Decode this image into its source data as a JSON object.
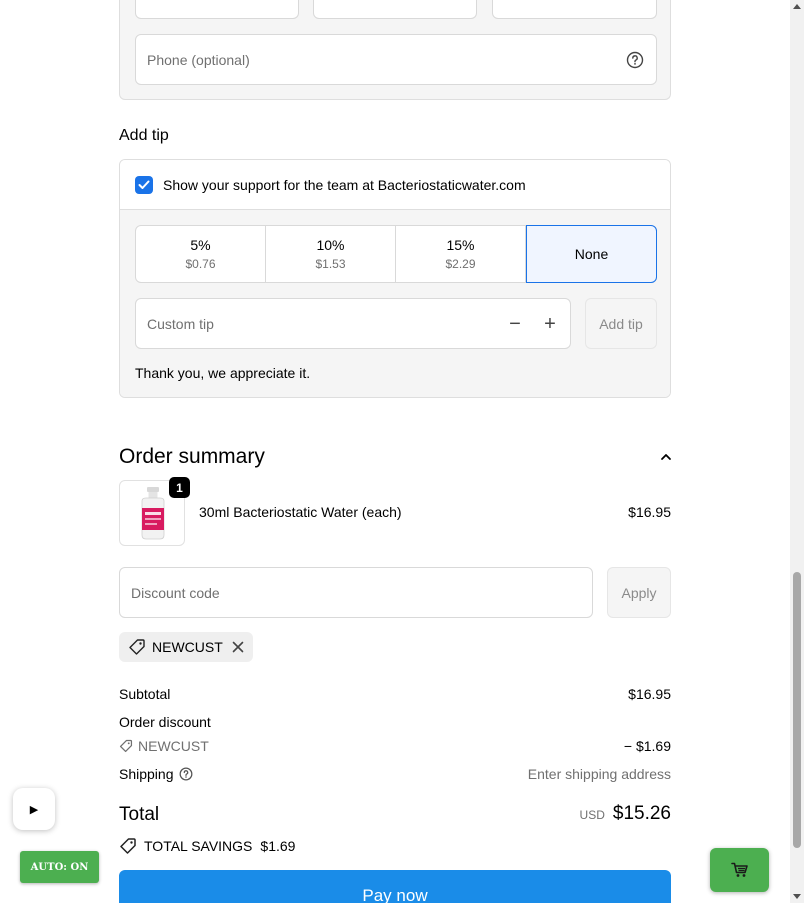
{
  "contact": {
    "phone_placeholder": "Phone (optional)"
  },
  "tip": {
    "title": "Add tip",
    "checkbox_label": "Show your support for the team at Bacteriostaticwater.com",
    "options": [
      {
        "percent": "5%",
        "amount": "$0.76"
      },
      {
        "percent": "10%",
        "amount": "$1.53"
      },
      {
        "percent": "15%",
        "amount": "$2.29"
      },
      {
        "label": "None",
        "selected": true
      }
    ],
    "custom_placeholder": "Custom tip",
    "decrement": "−",
    "increment": "+",
    "add_button": "Add tip",
    "thanks": "Thank you, we appreciate it."
  },
  "summary": {
    "title": "Order summary",
    "item": {
      "name": "30ml Bacteriostatic Water (each)",
      "price": "$16.95",
      "quantity": "1"
    },
    "discount_placeholder": "Discount code",
    "apply_button": "Apply",
    "applied_code": "NEWCUST",
    "subtotal_label": "Subtotal",
    "subtotal_value": "$16.95",
    "order_discount_label": "Order discount",
    "order_discount_code": "NEWCUST",
    "order_discount_value": "− $1.69",
    "shipping_label": "Shipping",
    "shipping_value": "Enter shipping address",
    "total_label": "Total",
    "currency": "USD",
    "total_value": "$15.26",
    "savings_label": "TOTAL SAVINGS",
    "savings_value": "$1.69",
    "pay_button": "Pay now"
  },
  "overlays": {
    "play_glyph": "▶",
    "auto_badge": "AUTO: ON"
  },
  "colors": {
    "accent": "#1a73e8",
    "pay": "#1a8ce8",
    "green": "#4caf50"
  }
}
